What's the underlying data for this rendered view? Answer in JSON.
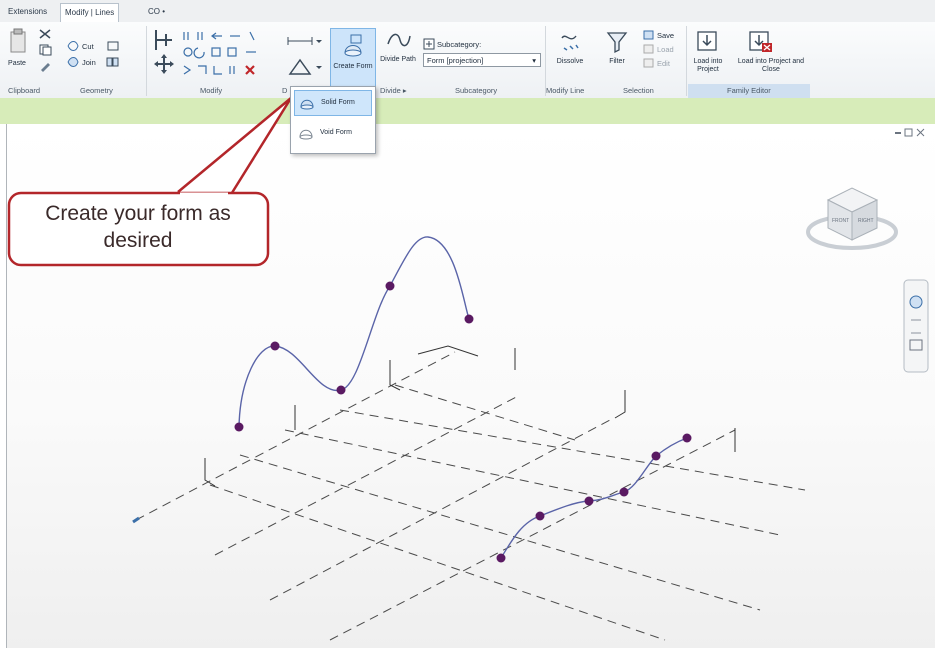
{
  "tabs": [
    "Extensions",
    "Modify | Lines",
    "CO •"
  ],
  "clipboard": {
    "paste": "Paste",
    "cut": "Cut",
    "join": "Join"
  },
  "panels": {
    "clipboard": "Clipboard",
    "geometry": "Geometry",
    "modify": "Modify",
    "draw_short": "D",
    "divide": "Divide ▸",
    "subcategory": "Subcategory",
    "modify_line": "Modify Line",
    "selection": "Selection",
    "family_editor": "Family Editor"
  },
  "buttons": {
    "create_form": "Create Form",
    "divide_path": "Divide Path",
    "subcategory_label": "Subcategory:",
    "subcategory_value": "Form [projection]",
    "dissolve": "Dissolve",
    "filter": "Filter",
    "save": "Save",
    "load": "Load",
    "edit": "Edit",
    "load_into_project": "Load into Project",
    "load_into_project_close": "Load into Project and Close"
  },
  "dropdown": {
    "solid_form": "Solid Form",
    "void_form": "Void Form"
  },
  "callout": {
    "text": "Create your form as desired"
  },
  "view_cube": {
    "front": "FRONT",
    "right": "RIGHT"
  },
  "colors": {
    "accent_green": "#d7ecb9",
    "curve": "#5a64a8",
    "point": "#5a1a62",
    "callout_border": "#b3262a"
  }
}
